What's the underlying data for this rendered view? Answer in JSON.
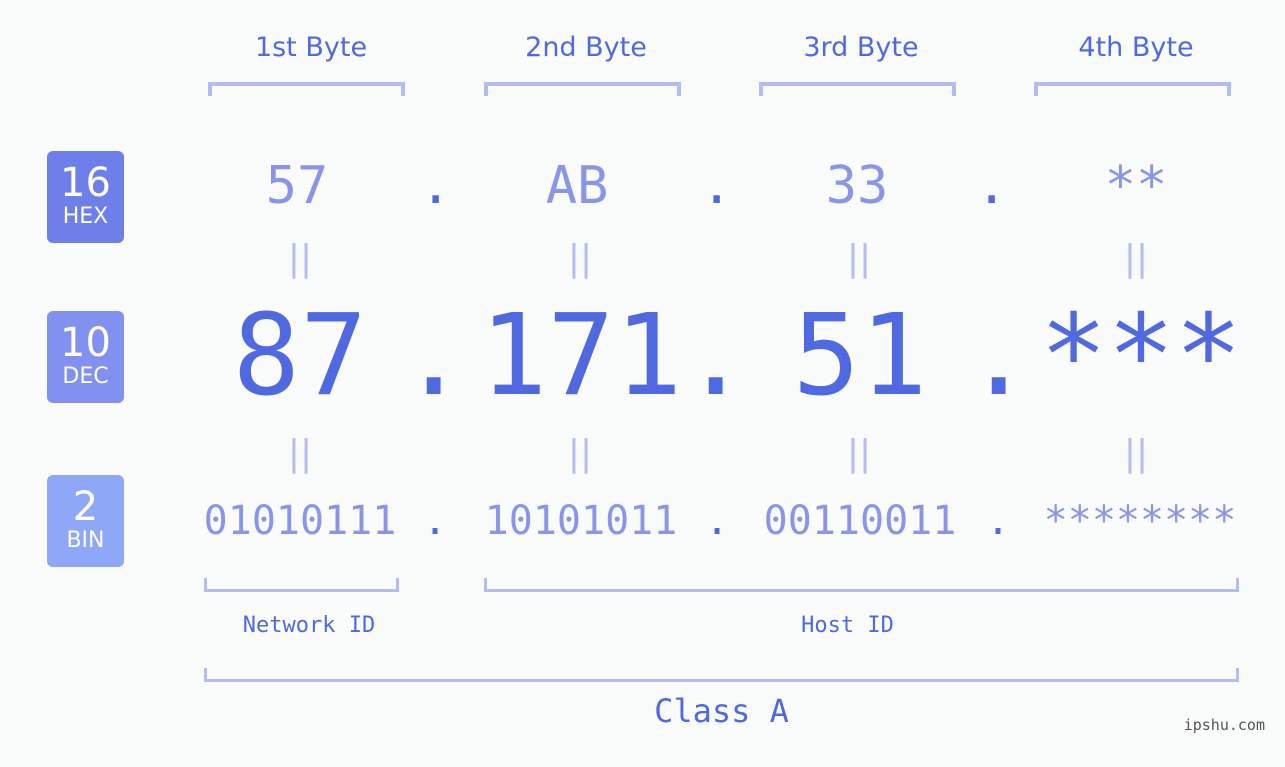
{
  "badges": [
    {
      "num": "16",
      "label": "HEX",
      "color": "#6f7fea"
    },
    {
      "num": "10",
      "label": "DEC",
      "color": "#8291f0"
    },
    {
      "num": "2",
      "label": "BIN",
      "color": "#8fa7f7"
    }
  ],
  "byte_headers": [
    "1st Byte",
    "2nd Byte",
    "3rd Byte",
    "4th Byte"
  ],
  "hex": [
    "57",
    "AB",
    "33",
    "**"
  ],
  "dec": [
    "87",
    "171",
    "51",
    "***"
  ],
  "bin": [
    "01010111",
    "10101011",
    "00110011",
    "********"
  ],
  "separator": ".",
  "equals": "||",
  "network_id_label": "Network ID",
  "host_id_label": "Host ID",
  "class_label": "Class A",
  "watermark": "ipshu.com",
  "colors": {
    "accent": "#5069e0",
    "light": "#8a95ea",
    "bracket": "#b3bdf5"
  }
}
